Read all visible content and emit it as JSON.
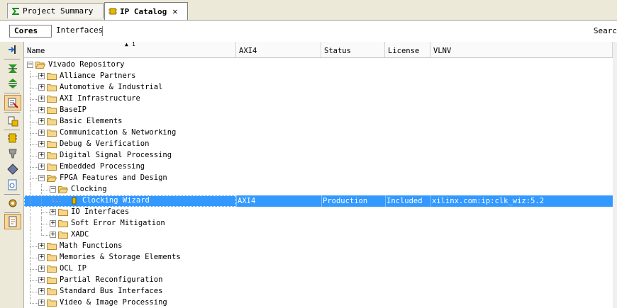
{
  "tabs": [
    {
      "label": "Project Summary",
      "icon": "sigma-icon",
      "active": false
    },
    {
      "label": "IP Catalog",
      "icon": "ip-chip-icon",
      "active": true
    }
  ],
  "subtabs": [
    {
      "label": "Cores",
      "active": true
    },
    {
      "label": "Interfaces",
      "active": false
    }
  ],
  "search_label": "Searc",
  "columns": {
    "sort_indicator": "1",
    "name": "Name",
    "axi4": "AXI4",
    "status": "Status",
    "license": "License",
    "vlnv": "VLNV"
  },
  "toolbar_icons": [
    "expand-to-level-icon",
    "collapse-all-icon",
    "expand-all-icon",
    "filter-icon",
    "customize-ip-icon",
    "add-repository-icon",
    "search-ip-icon",
    "properties-icon",
    "documentation-icon",
    "settings-gear-icon",
    "report-icon"
  ],
  "tree": [
    {
      "label": "Vivado Repository",
      "level": 0,
      "expanded": true
    },
    {
      "label": "Alliance Partners",
      "level": 1
    },
    {
      "label": "Automotive & Industrial",
      "level": 1
    },
    {
      "label": "AXI Infrastructure",
      "level": 1
    },
    {
      "label": "BaseIP",
      "level": 1
    },
    {
      "label": "Basic Elements",
      "level": 1
    },
    {
      "label": "Communication & Networking",
      "level": 1
    },
    {
      "label": "Debug & Verification",
      "level": 1
    },
    {
      "label": "Digital Signal Processing",
      "level": 1
    },
    {
      "label": "Embedded Processing",
      "level": 1
    },
    {
      "label": "FPGA Features and Design",
      "level": 1,
      "expanded": true
    },
    {
      "label": "Clocking",
      "level": 2,
      "expanded": true
    },
    {
      "label": "Clocking Wizard",
      "level": 3,
      "leaf": true,
      "selected": true,
      "axi4": "AXI4",
      "status": "Production",
      "license": "Included",
      "vlnv": "xilinx.com:ip:clk_wiz:5.2"
    },
    {
      "label": "IO Interfaces",
      "level": 2
    },
    {
      "label": "Soft Error Mitigation",
      "level": 2
    },
    {
      "label": "XADC",
      "level": 2
    },
    {
      "label": "Math Functions",
      "level": 1
    },
    {
      "label": "Memories & Storage Elements",
      "level": 1
    },
    {
      "label": "OCL IP",
      "level": 1
    },
    {
      "label": "Partial Reconfiguration",
      "level": 1
    },
    {
      "label": "Standard Bus Interfaces",
      "level": 1
    },
    {
      "label": "Video & Image Processing",
      "level": 1
    }
  ],
  "colors": {
    "selection": "#3399ff",
    "folder_fill": "#f5d68a",
    "folder_stroke": "#b48a2c",
    "ip_leaf_icon": "#e8b800",
    "toolbar_pressed": "#f5d7a0"
  }
}
